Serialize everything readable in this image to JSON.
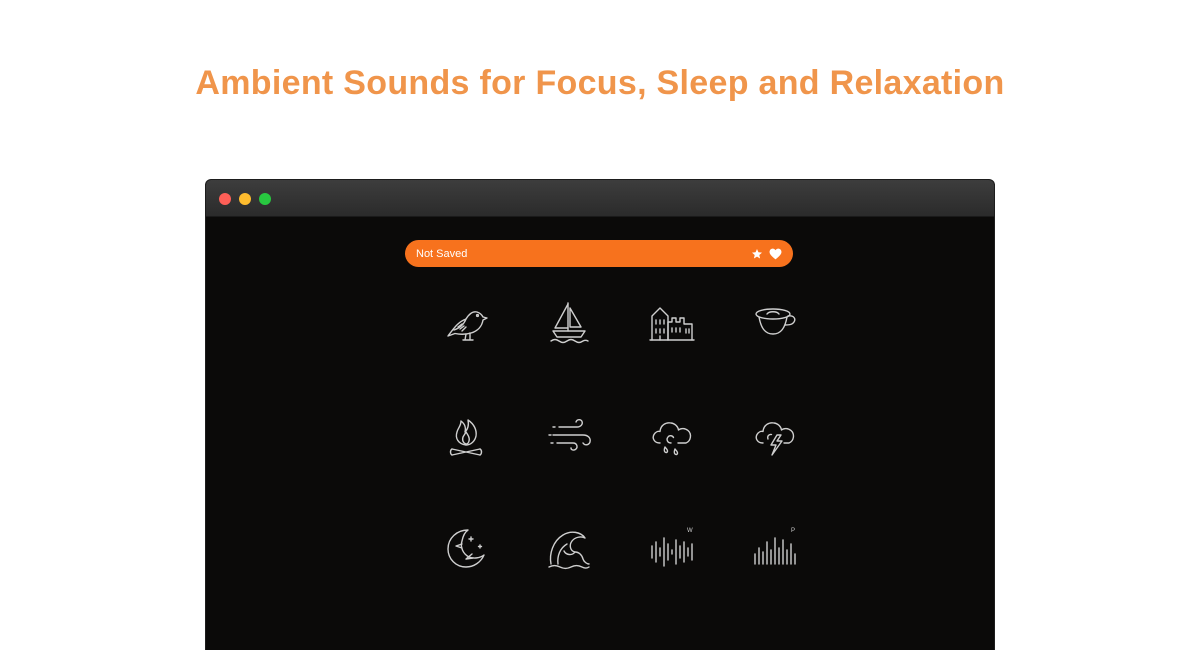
{
  "headline": {
    "text": "Ambient Sounds for Focus, Sleep and Relaxation",
    "color": "#f0954b"
  },
  "window": {
    "traffic_lights": {
      "close": "#fe5f57",
      "minimize": "#febc2e",
      "zoom": "#28c840"
    }
  },
  "save_bar": {
    "status": "Not Saved",
    "color": "#f7721d",
    "actions": [
      "star-icon",
      "heart-icon"
    ]
  },
  "sounds": [
    {
      "icon": "bird-icon"
    },
    {
      "icon": "sailboat-icon"
    },
    {
      "icon": "city-icon"
    },
    {
      "icon": "coffee-cup-icon"
    },
    {
      "icon": "campfire-icon"
    },
    {
      "icon": "wind-icon"
    },
    {
      "icon": "rain-cloud-icon"
    },
    {
      "icon": "thunderstorm-icon"
    },
    {
      "icon": "moon-night-icon"
    },
    {
      "icon": "ocean-wave-icon"
    },
    {
      "icon": "white-noise-icon",
      "badge": "W"
    },
    {
      "icon": "pink-noise-icon",
      "badge": "P"
    }
  ]
}
